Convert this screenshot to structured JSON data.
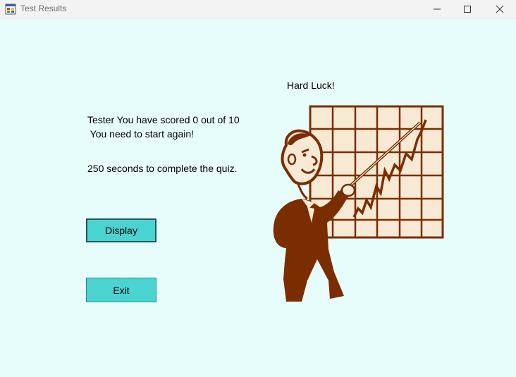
{
  "window": {
    "title": "Test Results",
    "app_icon": "windows-form-icon",
    "controls": [
      "minimize-icon",
      "maximize-icon",
      "close-icon"
    ]
  },
  "result": {
    "heading": "Hard Luck!",
    "score_line": "Tester You have scored 0 out of 10",
    "advice_line": " You need to start again!",
    "time_line": "250 seconds to complete the quiz."
  },
  "buttons": {
    "display_label": "Display",
    "exit_label": "Exit"
  },
  "picture": {
    "subject": "cartoon-man-pointing-at-rising-chart"
  },
  "colors": {
    "background": "#e7fdfc",
    "button": "#49d4d1",
    "illustration": "#7a2e00",
    "chart_fill": "#f7e9d4"
  }
}
